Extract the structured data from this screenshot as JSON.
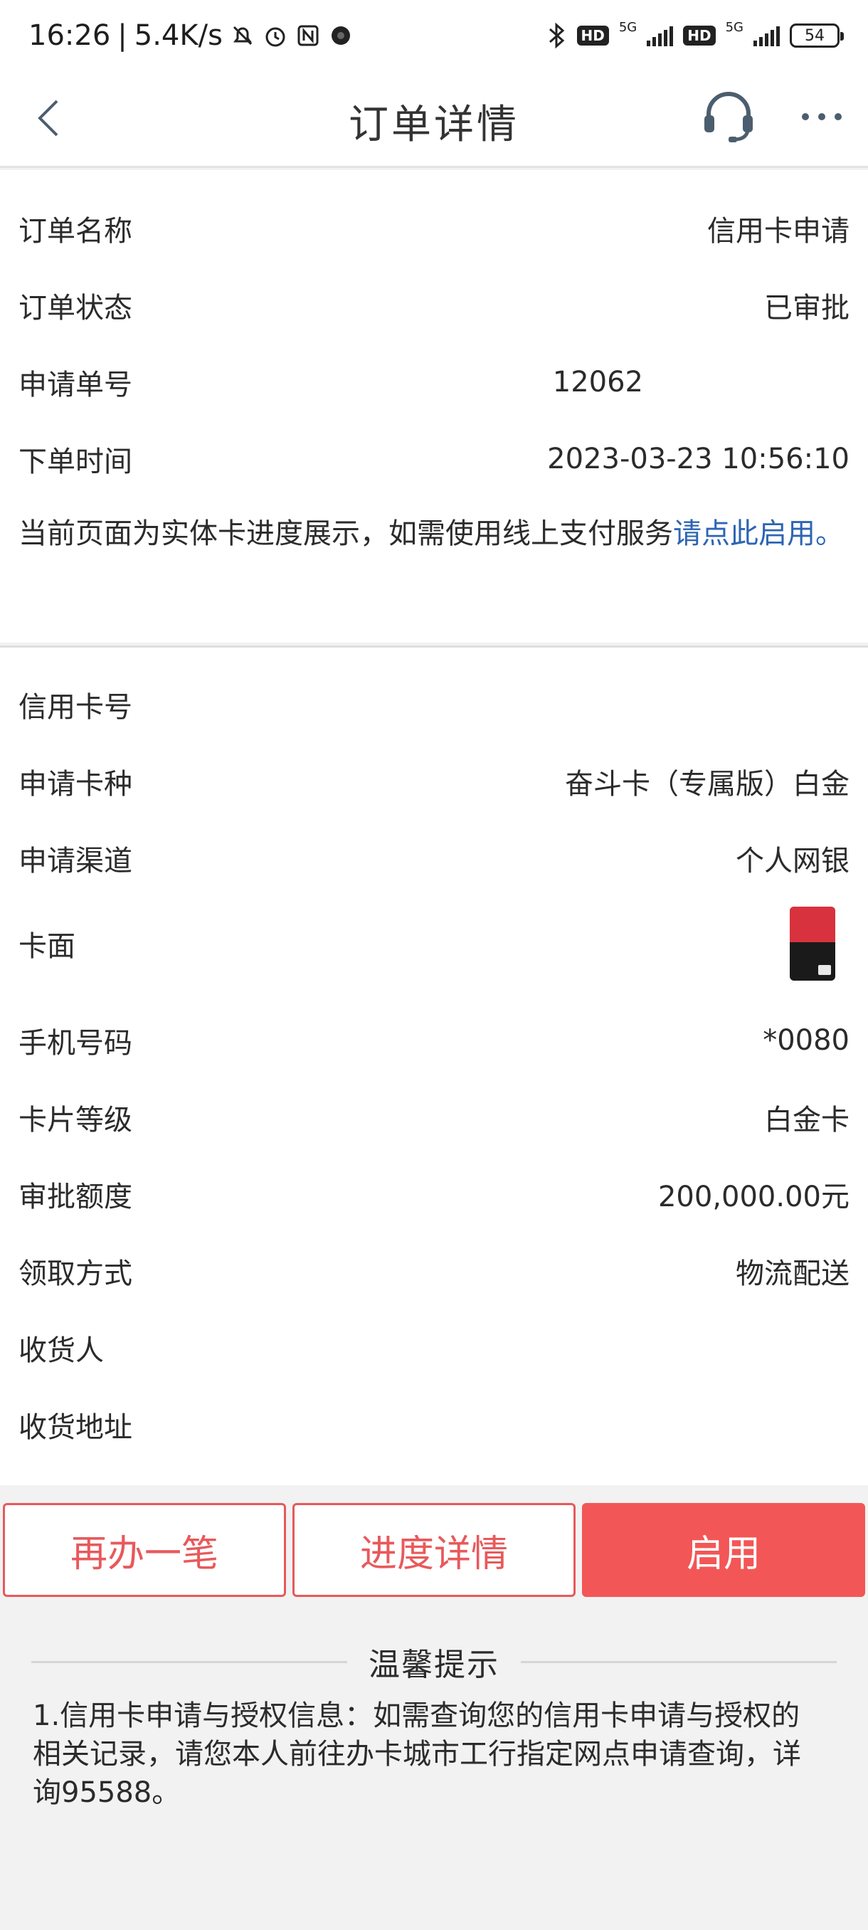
{
  "status_bar": {
    "time": "16:26",
    "net_speed": "5.4K/s",
    "hd1": "HD",
    "fiveg1": "5G",
    "hd2": "HD",
    "fiveg2": "5G",
    "battery": "54"
  },
  "nav": {
    "title": "订单详情"
  },
  "order": {
    "rows": [
      {
        "label": "订单名称",
        "value": "信用卡申请"
      },
      {
        "label": "订单状态",
        "value": "已审批"
      },
      {
        "label": "申请单号",
        "value": "12062"
      },
      {
        "label": "下单时间",
        "value": "2023-03-23 10:56:10"
      }
    ],
    "notice_text": "当前页面为实体卡进度展示，如需使用线上支付服务",
    "notice_link": "请点此启用。"
  },
  "card": {
    "rows": [
      {
        "label": "信用卡号",
        "value": ""
      },
      {
        "label": "申请卡种",
        "value": "奋斗卡（专属版）白金"
      },
      {
        "label": "申请渠道",
        "value": "个人网银"
      },
      {
        "label": "卡面",
        "value": ""
      },
      {
        "label": "手机号码",
        "value": "*0080"
      },
      {
        "label": "卡片等级",
        "value": "白金卡"
      },
      {
        "label": "审批额度",
        "value": "200,000.00元"
      },
      {
        "label": "领取方式",
        "value": "物流配送"
      },
      {
        "label": "收货人",
        "value": ""
      },
      {
        "label": "收货地址",
        "value": ""
      }
    ]
  },
  "buttons": {
    "again": "再办一笔",
    "progress": "进度详情",
    "activate": "启用"
  },
  "tips": {
    "title": "温馨提示",
    "body": "1.信用卡申请与授权信息：如需查询您的信用卡申请与授权的相关记录，请您本人前往办卡城市工行指定网点申请查询，详询95588。"
  },
  "colors": {
    "accent_red": "#f35656",
    "link_blue": "#2d65b3"
  }
}
